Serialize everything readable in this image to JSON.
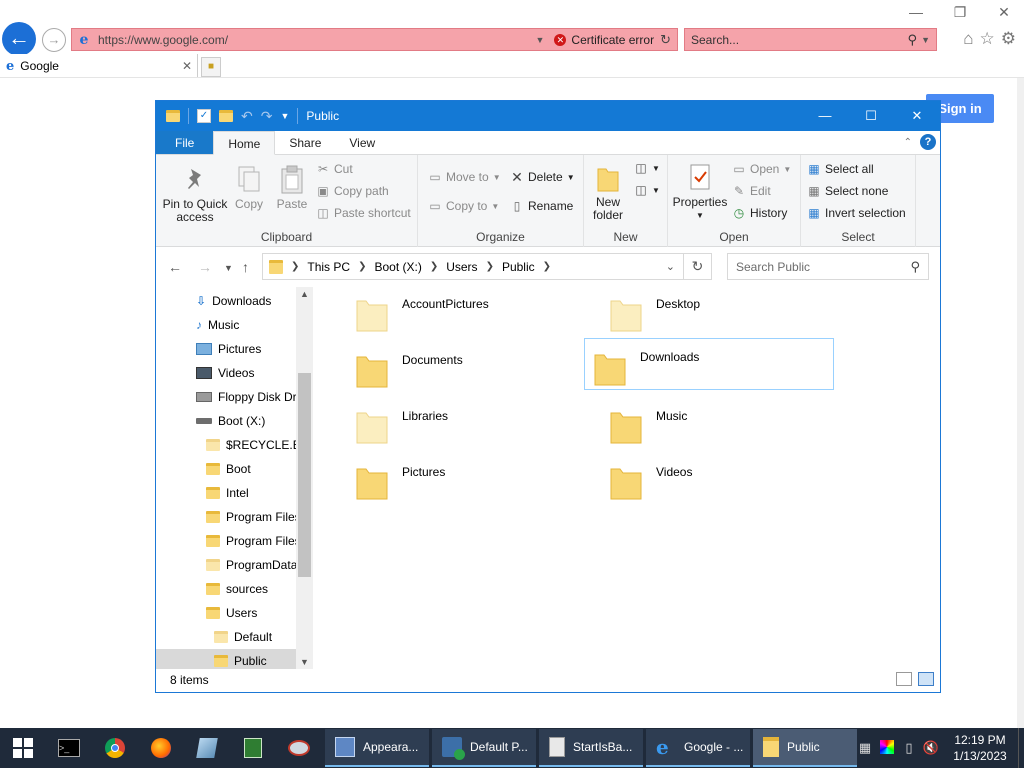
{
  "browser": {
    "address_url": "https://www.google.com/",
    "cert_error": "Certificate error",
    "search_placeholder": "Search...",
    "tab_title": "Google",
    "signin": "Sign in"
  },
  "explorer": {
    "title": "Public",
    "tabs": [
      "File",
      "Home",
      "Share",
      "View"
    ],
    "ribbon": {
      "clipboard": {
        "label": "Clipboard",
        "pin_line1": "Pin to Quick",
        "pin_line2": "access",
        "copy": "Copy",
        "paste": "Paste",
        "cut": "Cut",
        "copy_path": "Copy path",
        "paste_shortcut": "Paste shortcut"
      },
      "organize": {
        "label": "Organize",
        "move_to": "Move to",
        "copy_to": "Copy to",
        "delete": "Delete",
        "rename": "Rename"
      },
      "new": {
        "label": "New",
        "new_folder_line1": "New",
        "new_folder_line2": "folder"
      },
      "open": {
        "label": "Open",
        "properties": "Properties",
        "open": "Open",
        "edit": "Edit",
        "history": "History"
      },
      "select": {
        "label": "Select",
        "select_all": "Select all",
        "select_none": "Select none",
        "invert": "Invert selection"
      }
    },
    "breadcrumb": [
      "This PC",
      "Boot (X:)",
      "Users",
      "Public"
    ],
    "search_placeholder": "Search Public",
    "nav_items": [
      {
        "label": "Downloads",
        "icon": "download-icon"
      },
      {
        "label": "Music",
        "icon": "music-icon"
      },
      {
        "label": "Pictures",
        "icon": "pictures-icon"
      },
      {
        "label": "Videos",
        "icon": "videos-icon"
      },
      {
        "label": "Floppy Disk Dri",
        "icon": "floppy-icon"
      },
      {
        "label": "Boot (X:)",
        "icon": "drive-icon"
      },
      {
        "label": "$RECYCLE.BIN",
        "icon": "folder-icon"
      },
      {
        "label": "Boot",
        "icon": "folder-icon"
      },
      {
        "label": "Intel",
        "icon": "folder-icon"
      },
      {
        "label": "Program Files",
        "icon": "folder-icon"
      },
      {
        "label": "Program Files",
        "icon": "folder-icon"
      },
      {
        "label": "ProgramData",
        "icon": "folder-icon"
      },
      {
        "label": "sources",
        "icon": "folder-icon"
      },
      {
        "label": "Users",
        "icon": "folder-icon"
      },
      {
        "label": "Default",
        "icon": "folder-icon"
      },
      {
        "label": "Public",
        "icon": "folder-icon"
      }
    ],
    "items": [
      "AccountPictures",
      "Desktop",
      "Documents",
      "Downloads",
      "Libraries",
      "Music",
      "Pictures",
      "Videos"
    ],
    "status": "8 items"
  },
  "taskbar": {
    "buttons": [
      "Appeara...",
      "Default P...",
      "StartIsBa...",
      "Google - ...",
      "Public"
    ],
    "time": "12:19 PM",
    "date": "1/13/2023"
  }
}
